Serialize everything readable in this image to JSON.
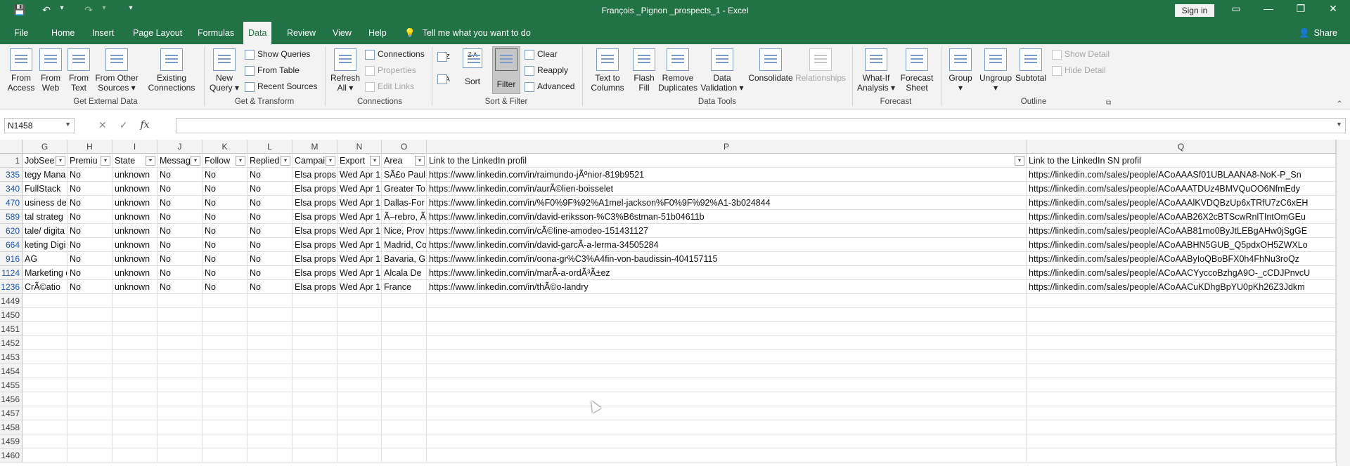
{
  "window": {
    "title": "François _Pignon _prospects_1  -  Excel",
    "signin_label": "Sign in",
    "controls": {
      "ribbon_display": "▭",
      "minimize": "—",
      "restore": "❐",
      "close": "✕"
    }
  },
  "qat": {
    "save": "💾",
    "undo": "↶",
    "undo_dd": "▾",
    "redo": "↷",
    "redo_dd": "▾",
    "customize": "▾"
  },
  "tabs": [
    "File",
    "Home",
    "Insert",
    "Page Layout",
    "Formulas",
    "Data",
    "Review",
    "View",
    "Help"
  ],
  "active_tab": "Data",
  "tell_me": "Tell me what you want to do",
  "share": "Share",
  "ribbon": {
    "groups": {
      "external": "Get External Data",
      "transform": "Get & Transform",
      "connections": "Connections",
      "sortfilter": "Sort & Filter",
      "datatools": "Data Tools",
      "forecast": "Forecast",
      "outline": "Outline"
    },
    "buttons": {
      "from_access": [
        "From",
        "Access"
      ],
      "from_web": [
        "From",
        "Web"
      ],
      "from_text": [
        "From",
        "Text"
      ],
      "from_other": [
        "From Other",
        "Sources ▾"
      ],
      "existing": [
        "Existing",
        "Connections"
      ],
      "new_query": [
        "New",
        "Query ▾"
      ],
      "show_queries": "Show Queries",
      "from_table": "From Table",
      "recent_sources": "Recent Sources",
      "refresh_all": [
        "Refresh",
        "All ▾"
      ],
      "connections": "Connections",
      "properties": "Properties",
      "edit_links": "Edit Links",
      "sort": "Sort",
      "sort_az": "A↓Z",
      "sort_za": "Z↓A",
      "sort_za_glyph": "Z A",
      "filter": "Filter",
      "clear": "Clear",
      "reapply": "Reapply",
      "advanced": "Advanced",
      "text_to_columns": [
        "Text to",
        "Columns"
      ],
      "flash_fill": [
        "Flash",
        "Fill"
      ],
      "remove_duplicates": [
        "Remove",
        "Duplicates"
      ],
      "data_validation": [
        "Data",
        "Validation ▾"
      ],
      "consolidate": "Consolidate",
      "relationships": "Relationships",
      "what_if": [
        "What-If",
        "Analysis ▾"
      ],
      "forecast_sheet": [
        "Forecast",
        "Sheet"
      ],
      "group": [
        "Group",
        "▾"
      ],
      "ungroup": [
        "Ungroup",
        "▾"
      ],
      "subtotal": "Subtotal",
      "show_detail": "Show Detail",
      "hide_detail": "Hide Detail"
    }
  },
  "formula_bar": {
    "name_box": "N1458",
    "cancel": "✕",
    "enter": "✓",
    "fx": "fx",
    "value": ""
  },
  "columns": [
    {
      "letter": "G",
      "header": "JobSee"
    },
    {
      "letter": "H",
      "header": "Premiu"
    },
    {
      "letter": "I",
      "header": "State"
    },
    {
      "letter": "J",
      "header": "Messag"
    },
    {
      "letter": "K",
      "header": "Follow"
    },
    {
      "letter": "L",
      "header": "Replied"
    },
    {
      "letter": "M",
      "header": "Campai"
    },
    {
      "letter": "N",
      "header": "Export"
    },
    {
      "letter": "O",
      "header": "Area"
    },
    {
      "letter": "P",
      "header": "Link to the LinkedIn profil"
    },
    {
      "letter": "Q",
      "header": "Link to the LinkedIn SN profil"
    }
  ],
  "rows": [
    {
      "num": "335",
      "cells": [
        "tegy Mana",
        "No",
        "unknown",
        "No",
        "No",
        "No",
        "Elsa props",
        "Wed Apr 1",
        "SÃ£o Paul",
        "https://www.linkedin.com/in/raimundo-jÃºnior-819b9521",
        "https://linkedin.com/sales/people/ACoAAASf01UBLAANA8-NoK-P_Sn"
      ]
    },
    {
      "num": "340",
      "cells": [
        " FullStack",
        "No",
        "unknown",
        "No",
        "No",
        "No",
        "Elsa props",
        "Wed Apr 1",
        "Greater To",
        "https://www.linkedin.com/in/aurÃ©lien-boisselet",
        "https://linkedin.com/sales/people/ACoAAATDUz4BMVQuOO6NfmEdy"
      ]
    },
    {
      "num": "470",
      "cells": [
        "usiness de",
        "No",
        "unknown",
        "No",
        "No",
        "No",
        "Elsa props",
        "Wed Apr 1",
        "Dallas-For",
        "https://www.linkedin.com/in/%F0%9F%92%A1mel-jackson%F0%9F%92%A1-3b024844",
        "https://linkedin.com/sales/people/ACoAAAlKVDQBzUp6xTRfU7zC6xEH"
      ]
    },
    {
      "num": "589",
      "cells": [
        "tal strateg",
        "No",
        "unknown",
        "No",
        "No",
        "No",
        "Elsa props",
        "Wed Apr 1",
        "Ã–rebro, Ã",
        "https://www.linkedin.com/in/david-eriksson-%C3%B6stman-51b04611b",
        "https://linkedin.com/sales/people/ACoAAB26X2cBTScwRnlTIntOmGEu"
      ]
    },
    {
      "num": "620",
      "cells": [
        "tale/ digita",
        "No",
        "unknown",
        "No",
        "No",
        "No",
        "Elsa props",
        "Wed Apr 1",
        "Nice, Prov",
        "https://www.linkedin.com/in/cÃ©line-amodeo-151431127",
        "https://linkedin.com/sales/people/ACoAAB81mo0ByJtLEBgAHw0jSgGE"
      ]
    },
    {
      "num": "664",
      "cells": [
        "keting Digi",
        "No",
        "unknown",
        "No",
        "No",
        "No",
        "Elsa props",
        "Wed Apr 1",
        "Madrid, Co",
        "https://www.linkedin.com/in/david-garcÃ-a-lerma-34505284",
        "https://linkedin.com/sales/people/ACoAABHN5GUB_Q5pdxOH5ZWXLo"
      ]
    },
    {
      "num": "916",
      "cells": [
        "AG",
        "No",
        "unknown",
        "No",
        "No",
        "No",
        "Elsa props",
        "Wed Apr 1",
        "Bavaria, G",
        "https://www.linkedin.com/in/oona-gr%C3%A4fin-von-baudissin-404157115",
        "https://linkedin.com/sales/people/ACoAAByIoQBoBFX0h4FhNu3roQz"
      ]
    },
    {
      "num": "1124",
      "cells": [
        "Marketing d",
        "No",
        "unknown",
        "No",
        "No",
        "No",
        "Elsa props",
        "Wed Apr 1",
        "Alcala De",
        "https://www.linkedin.com/in/marÃ-a-ordÃ³Ã±ez",
        "https://linkedin.com/sales/people/ACoAACYyccoBzhgA9O-_cCDJPnvcU"
      ]
    },
    {
      "num": "1236",
      "cells": [
        " CrÃ©atio",
        "No",
        "unknown",
        "No",
        "No",
        "No",
        "Elsa props",
        "Wed Apr 1",
        "France",
        "https://www.linkedin.com/in/thÃ©o-landry",
        "https://linkedin.com/sales/people/ACoAACuKDhgBpYU0pKh26Z3Jdkm"
      ]
    }
  ],
  "empty_rows": [
    "1449",
    "1450",
    "1451",
    "1452",
    "1453",
    "1454",
    "1455",
    "1456",
    "1457",
    "1458",
    "1459",
    "1460"
  ],
  "header_row_num": "1",
  "filter_glyph": "▾",
  "filter_active_glyph": "⏷"
}
